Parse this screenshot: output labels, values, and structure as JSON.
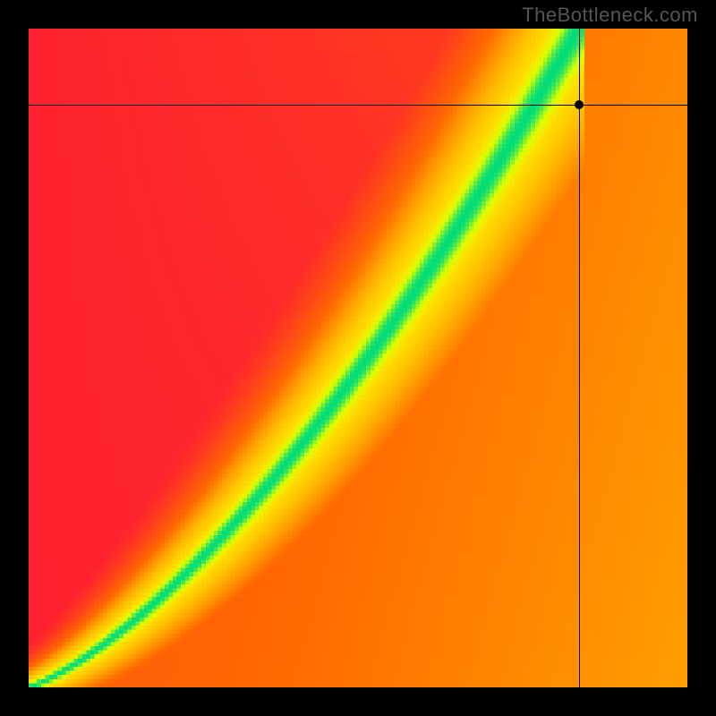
{
  "watermark": "TheBottleneck.com",
  "plot": {
    "grid_size": 160,
    "marker": {
      "x_frac": 0.835,
      "y_frac": 0.115
    },
    "ridge": {
      "a": 1.6,
      "b": 0.3,
      "c": 1.0,
      "width_base": 0.012,
      "width_scale": 0.11
    },
    "colors": {
      "floor": "#ff1a33",
      "mid_lo": "#ff6a00",
      "mid": "#ffe200",
      "peak": "#00e082",
      "peak_hi": "#00dc7a"
    }
  },
  "chart_data": {
    "type": "heatmap",
    "title": "",
    "xlabel": "",
    "ylabel": "",
    "xlim": [
      0,
      1
    ],
    "ylim": [
      0,
      1
    ],
    "legend": null,
    "annotations": [
      "TheBottleneck.com"
    ],
    "marker": {
      "x": 0.835,
      "y": 0.885
    },
    "description": "Two-variable compatibility/bottleneck heatmap. Value v(x,y) in [0,1] drawn with a red→orange→yellow→green colormap; green marks the optimal ridge.",
    "ridge_curve": [
      {
        "x": 0.0,
        "y": 0.0
      },
      {
        "x": 0.1,
        "y": 0.045
      },
      {
        "x": 0.2,
        "y": 0.116
      },
      {
        "x": 0.3,
        "y": 0.206
      },
      {
        "x": 0.4,
        "y": 0.312
      },
      {
        "x": 0.5,
        "y": 0.429
      },
      {
        "x": 0.6,
        "y": 0.555
      },
      {
        "x": 0.7,
        "y": 0.688
      },
      {
        "x": 0.75,
        "y": 0.757
      },
      {
        "x": 0.8,
        "y": 0.827
      },
      {
        "x": 0.85,
        "y": 0.899
      },
      {
        "x": 0.9,
        "y": 0.971
      },
      {
        "x": 0.93,
        "y": 1.0
      }
    ],
    "ridge_halfwidth": [
      {
        "x": 0.0,
        "w": 0.012
      },
      {
        "x": 0.25,
        "w": 0.04
      },
      {
        "x": 0.5,
        "w": 0.067
      },
      {
        "x": 0.75,
        "w": 0.095
      },
      {
        "x": 1.0,
        "w": 0.122
      }
    ],
    "sampled_field": [
      {
        "x": 0.1,
        "y": 0.1,
        "v": 0.35
      },
      {
        "x": 0.1,
        "y": 0.9,
        "v": 0.05
      },
      {
        "x": 0.9,
        "y": 0.1,
        "v": 0.3
      },
      {
        "x": 0.9,
        "y": 0.9,
        "v": 0.7
      },
      {
        "x": 0.5,
        "y": 0.43,
        "v": 1.0
      },
      {
        "x": 0.8,
        "y": 0.83,
        "v": 1.0
      },
      {
        "x": 0.835,
        "y": 0.885,
        "v": 0.98
      },
      {
        "x": 0.3,
        "y": 0.8,
        "v": 0.06
      },
      {
        "x": 0.7,
        "y": 0.3,
        "v": 0.32
      },
      {
        "x": 0.95,
        "y": 0.5,
        "v": 0.45
      },
      {
        "x": 0.95,
        "y": 0.98,
        "v": 0.92
      },
      {
        "x": 0.05,
        "y": 0.02,
        "v": 0.6
      }
    ],
    "color_stops": [
      {
        "v": 0.0,
        "color": "#ff1a33"
      },
      {
        "v": 0.35,
        "color": "#ff6a00"
      },
      {
        "v": 0.6,
        "color": "#ffe200"
      },
      {
        "v": 0.82,
        "color": "#d9ff00"
      },
      {
        "v": 1.0,
        "color": "#00dc7a"
      }
    ]
  }
}
